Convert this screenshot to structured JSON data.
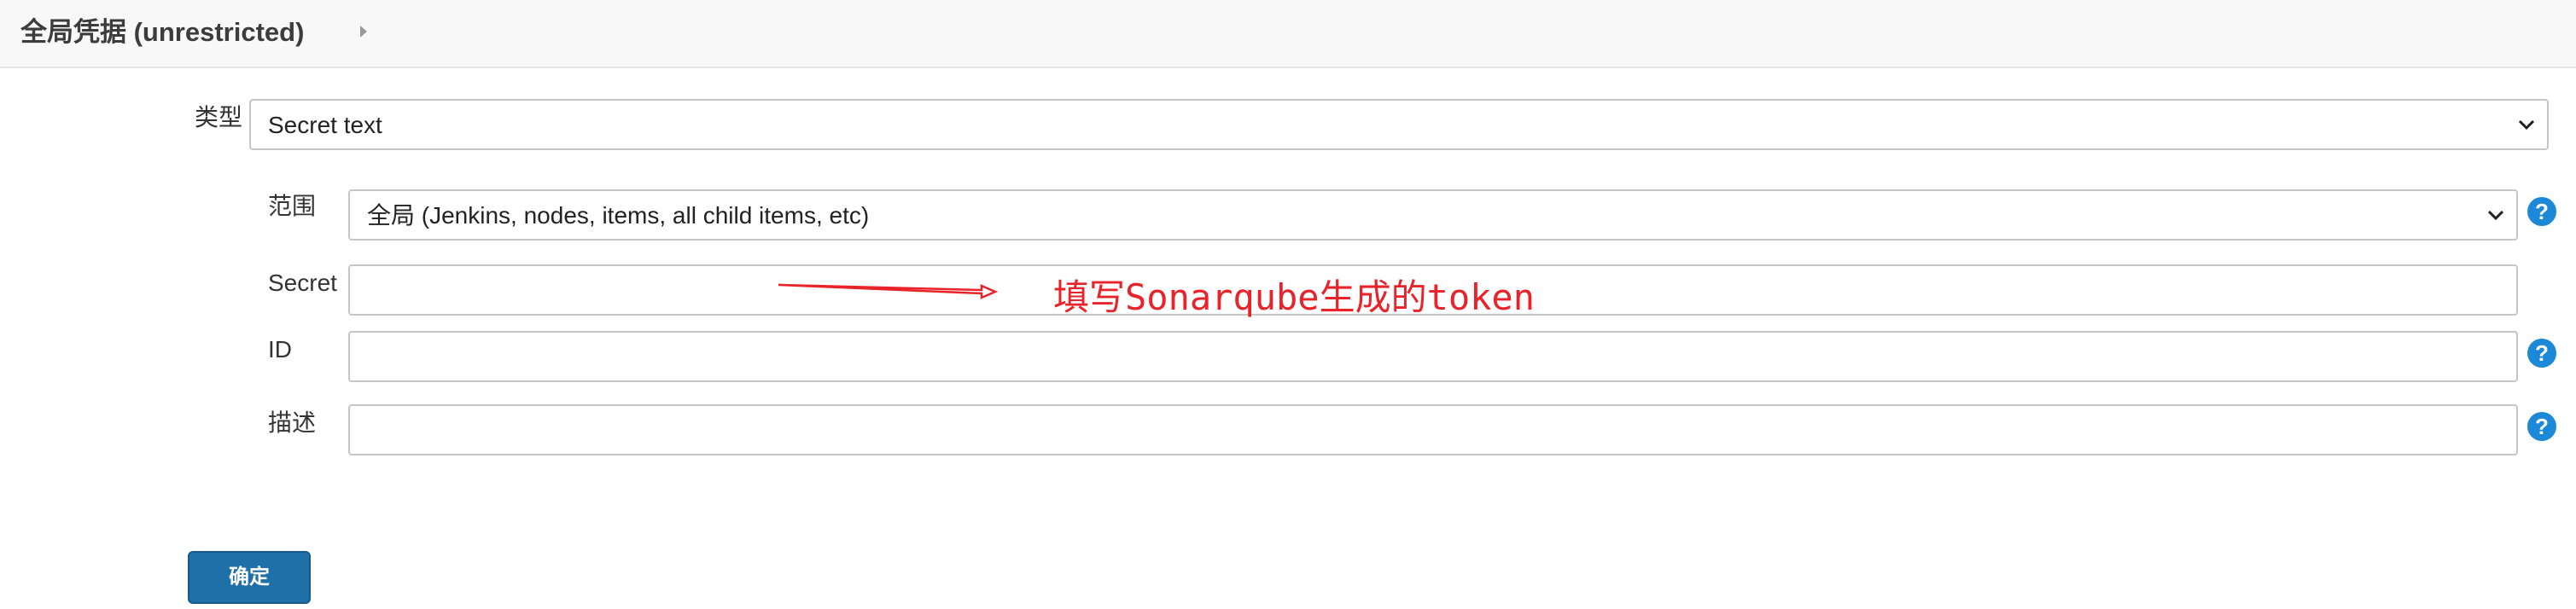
{
  "breadcrumb": {
    "title": "全局凭据 (unrestricted)"
  },
  "form": {
    "kind": {
      "label": "类型",
      "value": "Secret text"
    },
    "scope": {
      "label": "范围",
      "value": "全局 (Jenkins, nodes, items, all child items, etc)"
    },
    "secret": {
      "label": "Secret",
      "value": ""
    },
    "id": {
      "label": "ID",
      "value": ""
    },
    "description": {
      "label": "描述",
      "value": ""
    }
  },
  "annotation": {
    "text": "填写Sonarqube生成的token",
    "color": "#e8232a"
  },
  "buttons": {
    "ok": "确定"
  },
  "help": {
    "symbol": "?"
  },
  "colors": {
    "accent": "#1c88d8",
    "primary_button": "#1f6fa9"
  }
}
